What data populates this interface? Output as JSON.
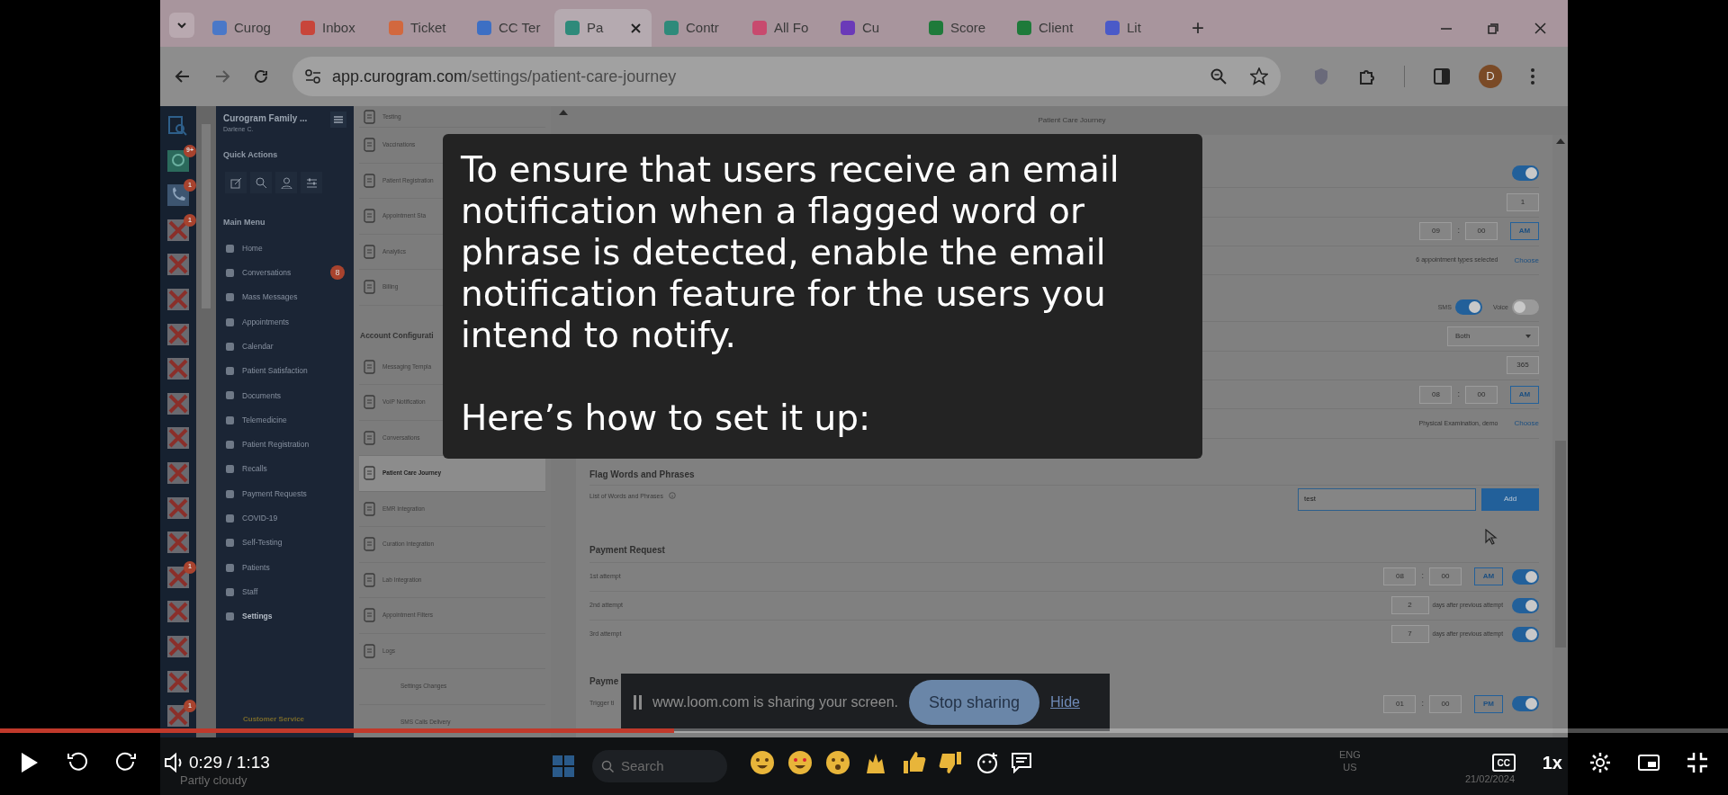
{
  "browser": {
    "tabs": [
      {
        "label": "Curog",
        "selected": false,
        "color": "#4a78c8"
      },
      {
        "label": "Inbox",
        "selected": false,
        "color": "#c8453a"
      },
      {
        "label": "Ticket",
        "selected": false,
        "color": "#d2683e"
      },
      {
        "label": "CC Ter",
        "selected": false,
        "color": "#3d6fc4"
      },
      {
        "label": "Pa",
        "selected": true,
        "color": "#2e8a7a"
      },
      {
        "label": "Contr",
        "selected": false,
        "color": "#2e8a7a"
      },
      {
        "label": "All Fo",
        "selected": false,
        "color": "#c84a6e"
      },
      {
        "label": "Cu",
        "selected": false,
        "color": "#6a3ab8"
      },
      {
        "label": "Score",
        "selected": false,
        "color": "#1e7a3a"
      },
      {
        "label": "Client",
        "selected": false,
        "color": "#1e7a3a"
      },
      {
        "label": "Lit",
        "selected": false,
        "color": "#4a5ac8"
      }
    ],
    "new_tab": "+",
    "url_host": "app.curogram.com",
    "url_path": "/settings/patient-care-journey",
    "profile": "D"
  },
  "icon_rail": [
    {
      "kind": "search"
    },
    {
      "kind": "chat",
      "badge": "9+"
    },
    {
      "kind": "phone",
      "badge": "1"
    },
    {
      "kind": "broken",
      "badge": "1"
    },
    {
      "kind": "broken"
    },
    {
      "kind": "broken"
    },
    {
      "kind": "broken"
    },
    {
      "kind": "broken"
    },
    {
      "kind": "broken"
    },
    {
      "kind": "broken"
    },
    {
      "kind": "broken"
    },
    {
      "kind": "broken"
    },
    {
      "kind": "broken"
    },
    {
      "kind": "broken",
      "badge": "1"
    },
    {
      "kind": "broken"
    },
    {
      "kind": "broken"
    },
    {
      "kind": "broken"
    },
    {
      "kind": "broken",
      "badge": "1"
    }
  ],
  "sidebar": {
    "org": "Curogram Family ...",
    "user": "Darlene C.",
    "quick_actions_title": "Quick Actions",
    "main_menu_title": "Main Menu",
    "items": [
      {
        "label": "Home",
        "selected": false
      },
      {
        "label": "Conversations",
        "badge": "8",
        "selected": false
      },
      {
        "label": "Mass Messages",
        "selected": false
      },
      {
        "label": "Appointments",
        "selected": false
      },
      {
        "label": "Calendar",
        "selected": false
      },
      {
        "label": "Patient Satisfaction",
        "selected": false
      },
      {
        "label": "Documents",
        "selected": false
      },
      {
        "label": "Telemedicine",
        "selected": false
      },
      {
        "label": "Patient Registration",
        "selected": false
      },
      {
        "label": "Recalls",
        "selected": false
      },
      {
        "label": "Payment Requests",
        "selected": false
      },
      {
        "label": "COVID-19",
        "selected": false
      },
      {
        "label": "Self-Testing",
        "selected": false
      },
      {
        "label": "Patients",
        "selected": false
      },
      {
        "label": "Staff",
        "selected": false
      },
      {
        "label": "Settings",
        "selected": true
      }
    ],
    "footer": "Customer Service"
  },
  "settings_nav": [
    {
      "kind": "item",
      "label": "Testing",
      "selected": false
    },
    {
      "kind": "item",
      "label": "Vaccinations",
      "selected": false
    },
    {
      "kind": "item",
      "label": "Patient Registration",
      "selected": false
    },
    {
      "kind": "item",
      "label": "Appointment Sta",
      "selected": false
    },
    {
      "kind": "item",
      "label": "Analytics",
      "selected": false
    },
    {
      "kind": "item",
      "label": "Billing",
      "selected": false
    },
    {
      "kind": "heading",
      "label": "Account Configurati"
    },
    {
      "kind": "item",
      "label": "Messaging Templa",
      "selected": false
    },
    {
      "kind": "item",
      "label": "VoIP Notification",
      "selected": false
    },
    {
      "kind": "item",
      "label": "Conversations",
      "selected": false
    },
    {
      "kind": "item",
      "label": "Patient Care Journey",
      "selected": true
    },
    {
      "kind": "item",
      "label": "EMR Integration",
      "selected": false
    },
    {
      "kind": "item",
      "label": "Curation Integration",
      "selected": false
    },
    {
      "kind": "item",
      "label": "Lab Integration",
      "selected": false
    },
    {
      "kind": "item",
      "label": "Appointment Filters",
      "selected": false
    },
    {
      "kind": "item",
      "label": "Logs",
      "selected": false
    },
    {
      "kind": "subitem",
      "label": "Settings Changes",
      "selected": false
    },
    {
      "kind": "subitem",
      "label": "SMS Calls Delivery",
      "selected": false
    }
  ],
  "page_title": "Patient Care Journey",
  "care_rows": [
    {
      "kind": "toggle",
      "on": true
    },
    {
      "kind": "number",
      "value": "1"
    },
    {
      "kind": "time",
      "hour": "09",
      "separator": ":",
      "minute": "00",
      "meridiem": "AM"
    },
    {
      "kind": "choose",
      "summary": "6 appointment types selected",
      "action": "Choose"
    },
    {
      "kind": "channels",
      "channels": [
        {
          "label": "SMS",
          "on": true
        },
        {
          "label": "Voice",
          "on": false
        }
      ]
    },
    {
      "kind": "select",
      "value": "Both"
    },
    {
      "kind": "number",
      "value": "365"
    },
    {
      "kind": "time",
      "hour": "08",
      "separator": ":",
      "minute": "00",
      "meridiem": "AM"
    },
    {
      "kind": "choose",
      "summary": "Physical Examination, demo",
      "action": "Choose"
    }
  ],
  "flag_words": {
    "title": "Flag Words and Phrases",
    "label": "List of Words and Phrases",
    "value": "test",
    "button": "Add"
  },
  "payment_request": {
    "title": "Payment Request",
    "rows": [
      {
        "kind": "time",
        "label": "1st attempt",
        "hour": "08",
        "separator": ":",
        "minute": "00",
        "meridiem": "AM",
        "on": true
      },
      {
        "kind": "days",
        "label": "2nd attempt",
        "value": "2",
        "suffix": "days after previous attempt",
        "on": true
      },
      {
        "kind": "days",
        "label": "3rd attempt",
        "value": "7",
        "suffix": "days after previous attempt",
        "on": true
      }
    ]
  },
  "next_section": {
    "title": "Payme",
    "row_label": "Trigger ti",
    "hour": "01",
    "separator": ":",
    "minute": "00",
    "meridiem": "PM",
    "on": true
  },
  "caption": [
    "To ensure that users receive an email notification when a flagged word or phrase is detected, enable the email notification feature for the users you intend to notify.",
    "Here’s how to set it up:"
  ],
  "loom_bar": {
    "message": "www.loom.com is sharing your screen.",
    "stop": "Stop sharing",
    "hide": "Hide"
  },
  "taskbar": {
    "weather": "Partly cloudy",
    "search": "Search",
    "lang": "ENG",
    "region": "US",
    "date": "21/02/2024"
  },
  "player": {
    "progress": {
      "level": 0.39
    },
    "time": "0:29 / 1:13",
    "captions": "CC",
    "speed": "1x"
  }
}
